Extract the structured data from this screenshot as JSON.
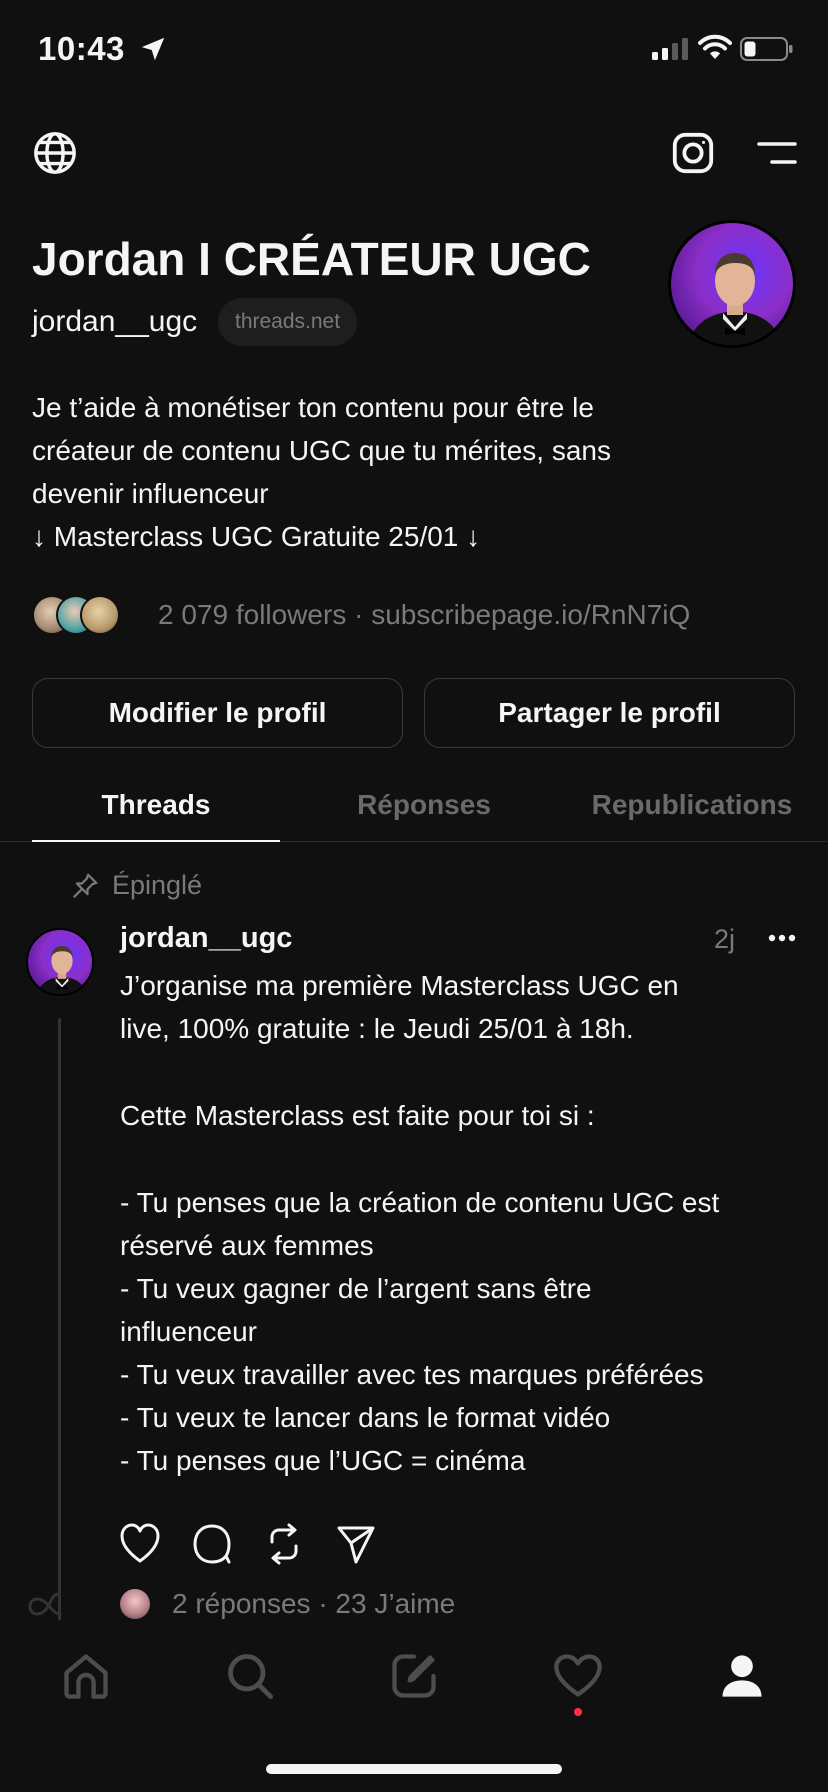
{
  "status_bar": {
    "time": "10:43"
  },
  "profile": {
    "display_name": "Jordan I CRÉATEUR UGC",
    "username": "jordan__ugc",
    "domain_badge": "threads.net",
    "bio_lines": [
      "Je t’aide à monétiser ton contenu pour être le",
      "créateur de contenu UGC que tu mérites, sans",
      "devenir influenceur",
      "↓ Masterclass UGC Gratuite 25/01 ↓"
    ],
    "followers_text": "2 079 followers · subscribepage.io/RnN7iQ"
  },
  "buttons": {
    "edit_profile": "Modifier le profil",
    "share_profile": "Partager le profil"
  },
  "tabs": [
    "Threads",
    "Réponses",
    "Republications"
  ],
  "post": {
    "pinned_label": "Épinglé",
    "author": "jordan__ugc",
    "time": "2j",
    "lines": [
      "J’organise ma première Masterclass UGC en",
      "live, 100% gratuite : le Jeudi 25/01 à 18h.",
      "",
      "Cette Masterclass est faite pour toi si :",
      "",
      "- Tu penses que la création de contenu UGC est",
      "réservé aux femmes",
      "- Tu veux gagner de l’argent sans être",
      "influenceur",
      "- Tu veux travailler avec tes marques préférées",
      "- Tu veux te lancer dans le format vidéo",
      "- Tu penses que l’UGC = cinéma"
    ],
    "stats": "2 réponses · 23 J’aime"
  },
  "icons": {
    "status": [
      "location-arrow-icon",
      "signal-icon",
      "wifi-icon",
      "battery-icon"
    ],
    "header": [
      "globe-icon",
      "instagram-icon",
      "menu-icon"
    ],
    "post_actions": [
      "heart-icon",
      "comment-icon",
      "repost-icon",
      "share-icon"
    ],
    "tab_bar": [
      "home-icon",
      "search-icon",
      "compose-icon",
      "activity-heart-icon",
      "profile-icon"
    ]
  },
  "colors": {
    "background": "#101010",
    "text": "#f3f5f7",
    "secondary_text": "#7a7a7a",
    "notification_dot": "#ff3040"
  }
}
